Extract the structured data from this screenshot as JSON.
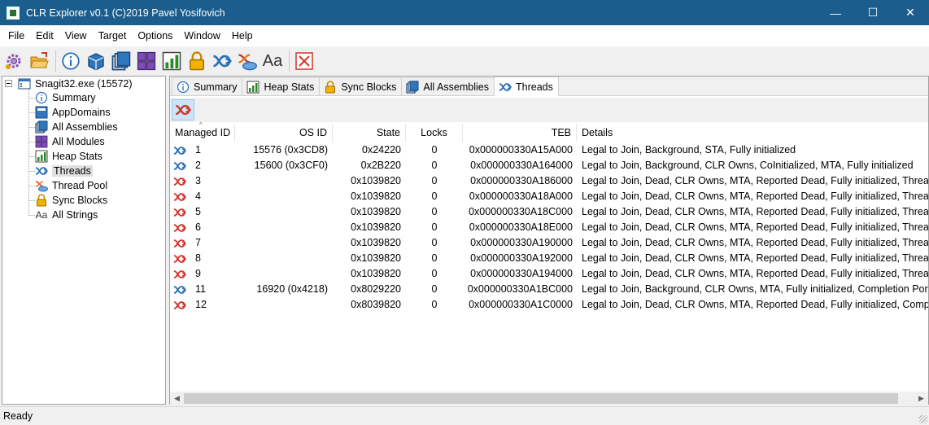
{
  "window": {
    "title": "CLR Explorer v0.1 (C)2019 Pavel Yosifovich"
  },
  "window_controls": {
    "minimize": "—",
    "maximize": "☐",
    "close": "✕"
  },
  "menu": [
    "File",
    "Edit",
    "View",
    "Target",
    "Options",
    "Window",
    "Help"
  ],
  "toolbar": {
    "buttons": [
      "gear-attach-icon",
      "open-folder-icon",
      "info-icon",
      "assembly-icon",
      "modules-icon",
      "appdomains-icon",
      "heap-stats-icon",
      "lock-icon",
      "threads-icon",
      "thread-pool-icon",
      "font-icon",
      "close-icon"
    ],
    "font_label": "Aa"
  },
  "tree": {
    "root": "Snagit32.exe (15572)",
    "items": [
      "Summary",
      "AppDomains",
      "All Assemblies",
      "All Modules",
      "Heap Stats",
      "Threads",
      "Thread Pool",
      "Sync Blocks",
      "All Strings"
    ],
    "selected": "Threads",
    "strings_icon_text": "Aa"
  },
  "tabs": [
    "Summary",
    "Heap Stats",
    "Sync Blocks",
    "All Assemblies",
    "Threads"
  ],
  "active_tab": "Threads",
  "columns": [
    "Managed ID",
    "OS ID",
    "State",
    "Locks",
    "TEB",
    "Details"
  ],
  "rows": [
    {
      "id": "1",
      "os": "15576 (0x3CD8)",
      "state": "0x24220",
      "locks": "0",
      "teb": "0x000000330A15A000",
      "details": "Legal to Join, Background, STA, Fully initialized",
      "alive": true
    },
    {
      "id": "2",
      "os": "15600 (0x3CF0)",
      "state": "0x2B220",
      "locks": "0",
      "teb": "0x000000330A164000",
      "details": "Legal to Join, Background, CLR Owns, CoInitialized, MTA, Fully initialized",
      "alive": true
    },
    {
      "id": "3",
      "os": "",
      "state": "0x1039820",
      "locks": "0",
      "teb": "0x000000330A186000",
      "details": "Legal to Join, Dead, CLR Owns, MTA, Reported Dead, Fully initialized, Thread Poo",
      "alive": false
    },
    {
      "id": "4",
      "os": "",
      "state": "0x1039820",
      "locks": "0",
      "teb": "0x000000330A18A000",
      "details": "Legal to Join, Dead, CLR Owns, MTA, Reported Dead, Fully initialized, Thread Poo",
      "alive": false
    },
    {
      "id": "5",
      "os": "",
      "state": "0x1039820",
      "locks": "0",
      "teb": "0x000000330A18C000",
      "details": "Legal to Join, Dead, CLR Owns, MTA, Reported Dead, Fully initialized, Thread Poo",
      "alive": false
    },
    {
      "id": "6",
      "os": "",
      "state": "0x1039820",
      "locks": "0",
      "teb": "0x000000330A18E000",
      "details": "Legal to Join, Dead, CLR Owns, MTA, Reported Dead, Fully initialized, Thread Poo",
      "alive": false
    },
    {
      "id": "7",
      "os": "",
      "state": "0x1039820",
      "locks": "0",
      "teb": "0x000000330A190000",
      "details": "Legal to Join, Dead, CLR Owns, MTA, Reported Dead, Fully initialized, Thread Poo",
      "alive": false
    },
    {
      "id": "8",
      "os": "",
      "state": "0x1039820",
      "locks": "0",
      "teb": "0x000000330A192000",
      "details": "Legal to Join, Dead, CLR Owns, MTA, Reported Dead, Fully initialized, Thread Poo",
      "alive": false
    },
    {
      "id": "9",
      "os": "",
      "state": "0x1039820",
      "locks": "0",
      "teb": "0x000000330A194000",
      "details": "Legal to Join, Dead, CLR Owns, MTA, Reported Dead, Fully initialized, Thread Poo",
      "alive": false
    },
    {
      "id": "11",
      "os": "16920 (0x4218)",
      "state": "0x8029220",
      "locks": "0",
      "teb": "0x000000330A1BC000",
      "details": "Legal to Join, Background, CLR Owns, MTA, Fully initialized, Completion Port",
      "alive": true
    },
    {
      "id": "12",
      "os": "",
      "state": "0x8039820",
      "locks": "0",
      "teb": "0x000000330A1C0000",
      "details": "Legal to Join, Dead, CLR Owns, MTA, Reported Dead, Fully initialized, Completion",
      "alive": false
    }
  ],
  "status": {
    "text": "Ready"
  },
  "colors": {
    "titlebar": "#1b5d8c",
    "alive_thread": "#2c6fb8",
    "dead_thread": "#d0342c",
    "selected_tool": "#cce4f7"
  }
}
